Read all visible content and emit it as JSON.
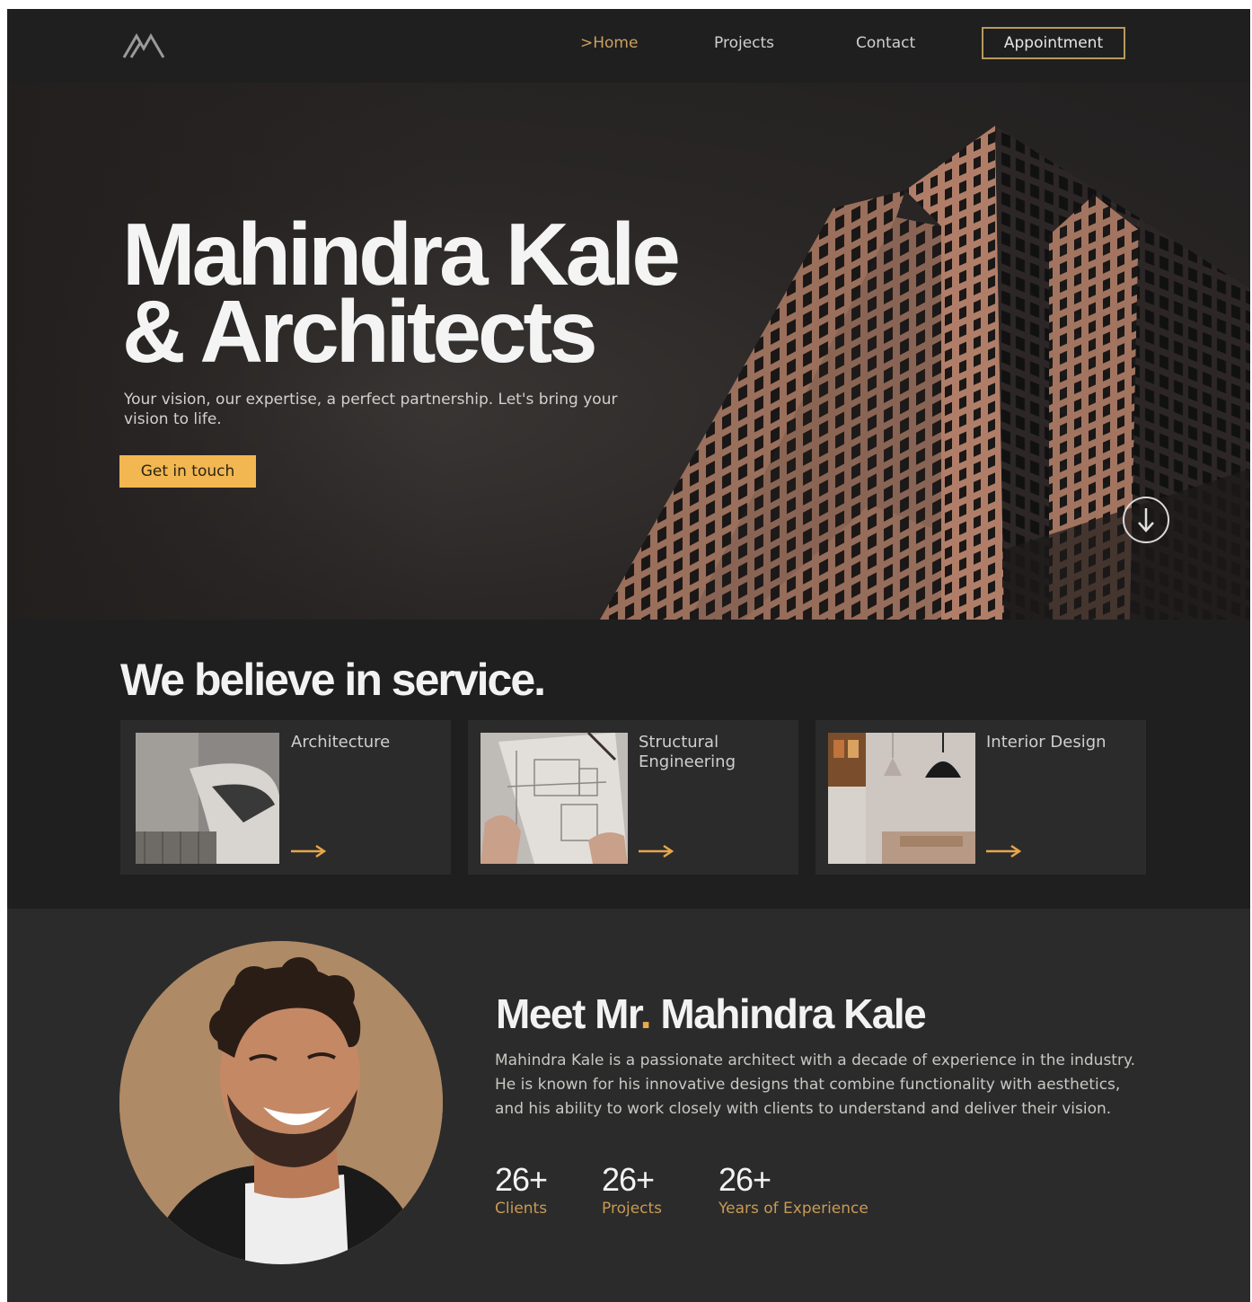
{
  "nav": {
    "logo_icon": "mountain-logo-icon",
    "links": [
      {
        "label": ">Home",
        "active": true
      },
      {
        "label": "Projects",
        "active": false
      },
      {
        "label": "Contact",
        "active": false
      }
    ],
    "appointment_label": "Appointment"
  },
  "hero": {
    "title_line1": "Mahindra Kale",
    "title_line2": "& Architects",
    "subtitle": "Your vision, our expertise, a perfect partnership. Let's bring your vision to life.",
    "cta_label": "Get in touch",
    "scroll_icon": "arrow-down-circle-icon"
  },
  "services": {
    "title": "We believe in service.",
    "cards": [
      {
        "title": "Architecture",
        "arrow_icon": "arrow-right-icon"
      },
      {
        "title": "Structural Engineering",
        "arrow_icon": "arrow-right-icon"
      },
      {
        "title": "Interior Design",
        "arrow_icon": "arrow-right-icon"
      }
    ]
  },
  "about": {
    "title_prefix": "Meet Mr",
    "title_dot": ".",
    "title_name": " Mahindra Kale",
    "body": "Mahindra Kale is a passionate architect with a decade of experience in the industry. He is known for his innovative designs that combine functionality with aesthetics, and his ability to work closely with clients to understand and deliver their vision.",
    "stats": [
      {
        "value": "26+",
        "label": "Clients"
      },
      {
        "value": "26+",
        "label": "Projects"
      },
      {
        "value": "26+",
        "label": "Years of Experience"
      }
    ]
  },
  "colors": {
    "accent_gold": "#c9a160",
    "cta_yellow": "#f2b750",
    "background": "#232323"
  }
}
